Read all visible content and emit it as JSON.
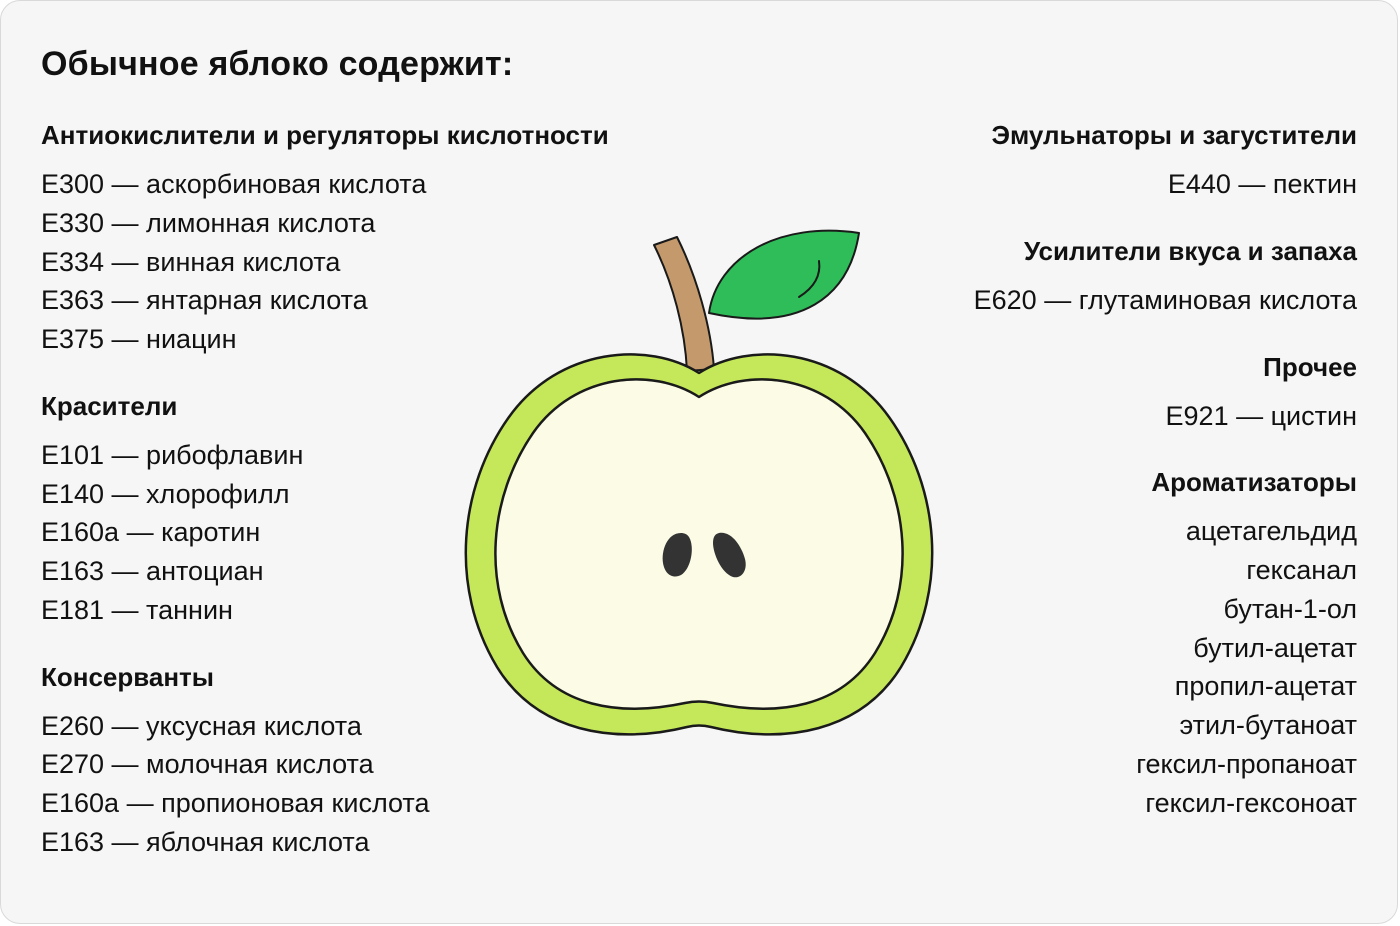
{
  "title": "Обычное яблоко содержит:",
  "left_sections": [
    {
      "title": "Антиокислители и регуляторы кислотности",
      "items": [
        "E300 — аскорбиновая кислота",
        "E330 — лимонная кислота",
        "E334 — винная кислота",
        "E363 — янтарная кислота",
        "E375 — ниацин"
      ]
    },
    {
      "title": "Красители",
      "items": [
        "E101 — рибофлавин",
        "E140 — хлорофилл",
        "E160a — каротин",
        "E163 — антоциан",
        "E181 — таннин"
      ]
    },
    {
      "title": "Консерванты",
      "items": [
        "E260 — уксусная кислота",
        "E270 — молочная кислота",
        "E160a — пропионовая кислота",
        "E163 — яблочная кислота"
      ]
    }
  ],
  "right_sections": [
    {
      "title": "Эмульнаторы и загустители",
      "items": [
        "E440 — пектин"
      ]
    },
    {
      "title": "Усилители вкуса и запаха",
      "items": [
        "E620 — глутаминовая кислота"
      ]
    },
    {
      "title": "Прочее",
      "items": [
        "E921 — цистин"
      ]
    },
    {
      "title": "Ароматизаторы",
      "items": [
        "ацетагельдид",
        "гексанал",
        "бутан-1-ол",
        "бутил-ацетат",
        "пропил-ацетат",
        "этил-бутаноат",
        "гексил-пропаноат",
        "гексил-гексоноат"
      ]
    }
  ],
  "illustration": {
    "icon": "apple-half-icon",
    "colors": {
      "skin": "#c5e85a",
      "flesh": "#fbfbe6",
      "outline": "#1a1a1a",
      "stem": "#c49a6c",
      "leaf": "#2ebd59",
      "seed": "#333333"
    }
  }
}
